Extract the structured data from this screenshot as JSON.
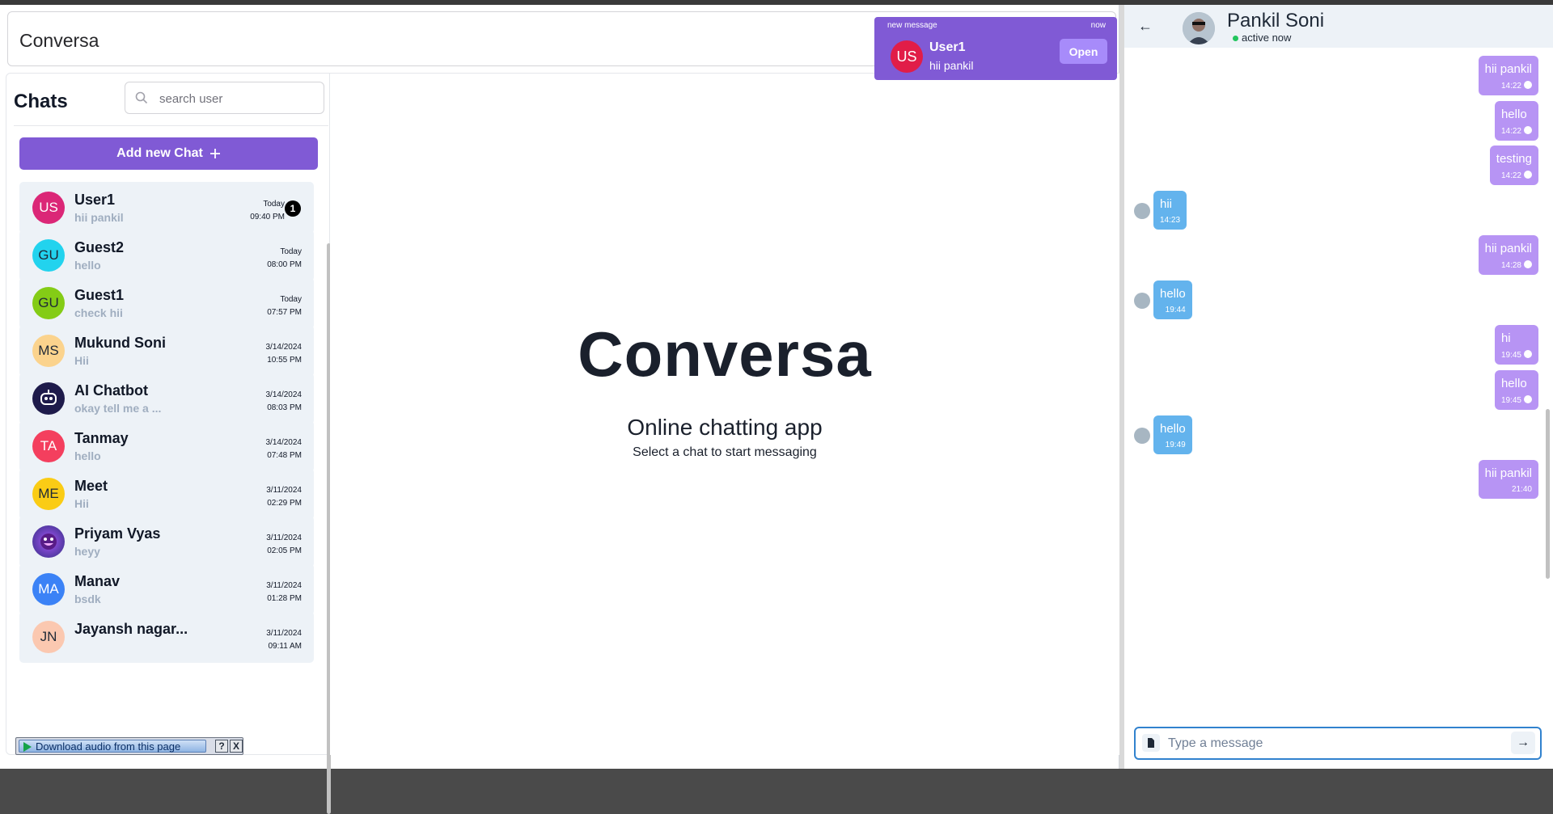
{
  "app": {
    "brand": "Conversa"
  },
  "sidebar": {
    "title": "Chats",
    "search_placeholder": "search user",
    "add_button_label": "Add new Chat",
    "chats": [
      {
        "initials": "US",
        "name": "User1",
        "last": "hii pankil",
        "date": "Today",
        "time": "09:40 PM",
        "unread": "1",
        "color": "#db2777"
      },
      {
        "initials": "GU",
        "name": "Guest2",
        "last": "hello",
        "date": "Today",
        "time": "08:00 PM",
        "color": "#22d3ee"
      },
      {
        "initials": "GU",
        "name": "Guest1",
        "last": "check hii",
        "date": "Today",
        "time": "07:57 PM",
        "color": "#84cc16"
      },
      {
        "initials": "MS",
        "name": "Mukund Soni",
        "last": "Hii",
        "date": "3/14/2024",
        "time": "10:55 PM",
        "color": "#fbd38d"
      },
      {
        "initials": "",
        "name": "AI Chatbot",
        "last": "okay tell me a ...",
        "date": "3/14/2024",
        "time": "08:03 PM",
        "color": "#1e1b4b"
      },
      {
        "initials": "TA",
        "name": "Tanmay",
        "last": "hello",
        "date": "3/14/2024",
        "time": "07:48 PM",
        "color": "#f43f5e"
      },
      {
        "initials": "ME",
        "name": "Meet",
        "last": "Hii",
        "date": "3/11/2024",
        "time": "02:29 PM",
        "color": "#facc15"
      },
      {
        "initials": "",
        "name": "Priyam Vyas",
        "last": "heyy",
        "date": "3/11/2024",
        "time": "02:05 PM",
        "color": "#7c3aed"
      },
      {
        "initials": "MA",
        "name": "Manav",
        "last": "bsdk",
        "date": "3/11/2024",
        "time": "01:28 PM",
        "color": "#3b82f6"
      },
      {
        "initials": "JN",
        "name": "Jayansh nagar...",
        "last": "",
        "date": "3/11/2024",
        "time": "09:11 AM",
        "color": "#fbc8b0"
      }
    ]
  },
  "main": {
    "title": "Conversa",
    "subtitle": "Online chatting app",
    "hint": "Select a chat to start messaging"
  },
  "toast": {
    "label": "new message",
    "time": "now",
    "initials": "US",
    "sender": "User1",
    "message": "hii pankil",
    "open_label": "Open"
  },
  "extension": {
    "download_label": "Download audio from this page",
    "help_label": "?",
    "close_label": "X"
  },
  "chat": {
    "back_label": "←",
    "contact_name": "Pankil Soni",
    "status": "active now",
    "messages": [
      {
        "dir": "out",
        "text": "hii pankil",
        "time": "14:22"
      },
      {
        "dir": "out",
        "text": "hello",
        "time": "14:22"
      },
      {
        "dir": "out",
        "text": "testing",
        "time": "14:22"
      },
      {
        "dir": "in",
        "text": "hii",
        "time": "14:23"
      },
      {
        "dir": "out",
        "text": "hii pankil",
        "time": "14:28"
      },
      {
        "dir": "in",
        "text": "hello",
        "time": "19:44"
      },
      {
        "dir": "out",
        "text": "hi",
        "time": "19:45"
      },
      {
        "dir": "out",
        "text": "hello",
        "time": "19:45"
      },
      {
        "dir": "in",
        "text": "hello",
        "time": "19:49"
      },
      {
        "dir": "out",
        "text": "hii pankil",
        "time": "21:40"
      }
    ],
    "composer_placeholder": "Type a message",
    "send_label": "→"
  },
  "colors": {
    "accent": "#805ad5",
    "outgoing": "#b794f4",
    "incoming": "#63b3ed",
    "panel": "#edf2f7"
  }
}
